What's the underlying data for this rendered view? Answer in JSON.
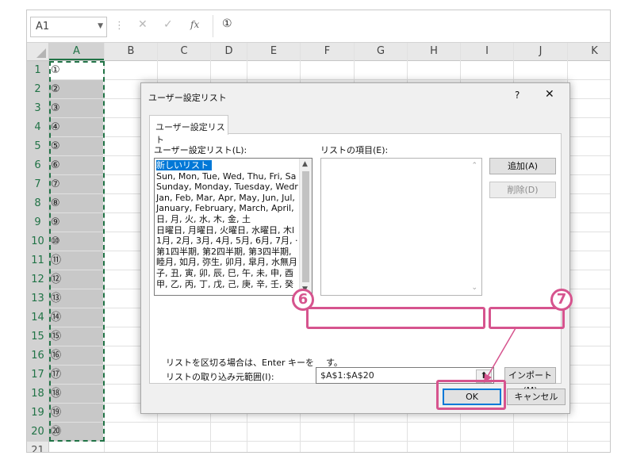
{
  "formula_bar": {
    "name_box": "A1",
    "cancel_symbol": "✕",
    "enter_symbol": "✓",
    "fx_symbol": "fx",
    "content": "①"
  },
  "columns": [
    "A",
    "B",
    "C",
    "D",
    "E",
    "F",
    "G",
    "H",
    "I",
    "J",
    "K"
  ],
  "rows": [
    {
      "n": "1",
      "a": "①"
    },
    {
      "n": "2",
      "a": "②"
    },
    {
      "n": "3",
      "a": "③"
    },
    {
      "n": "4",
      "a": "④"
    },
    {
      "n": "5",
      "a": "⑤"
    },
    {
      "n": "6",
      "a": "⑥"
    },
    {
      "n": "7",
      "a": "⑦"
    },
    {
      "n": "8",
      "a": "⑧"
    },
    {
      "n": "9",
      "a": "⑨"
    },
    {
      "n": "10",
      "a": "⑩"
    },
    {
      "n": "11",
      "a": "⑪"
    },
    {
      "n": "12",
      "a": "⑫"
    },
    {
      "n": "13",
      "a": "⑬"
    },
    {
      "n": "14",
      "a": "⑭"
    },
    {
      "n": "15",
      "a": "⑮"
    },
    {
      "n": "16",
      "a": "⑯"
    },
    {
      "n": "17",
      "a": "⑰"
    },
    {
      "n": "18",
      "a": "⑱"
    },
    {
      "n": "19",
      "a": "⑲"
    },
    {
      "n": "20",
      "a": "⑳"
    },
    {
      "n": "21",
      "a": ""
    }
  ],
  "dialog": {
    "title": "ユーザー設定リスト",
    "help": "?",
    "close": "✕",
    "tab": "ユーザー設定リスト",
    "list_label": "ユーザー設定リスト(L):",
    "entries_label": "リストの項目(E):",
    "list_items": [
      "新しいリスト",
      "Sun, Mon, Tue, Wed, Thu, Fri, Sa",
      "Sunday, Monday, Tuesday, Wedr",
      "Jan, Feb, Mar, Apr, May, Jun, Jul,",
      "January, February, March, April,",
      "日, 月, 火, 水, 木, 金, 土",
      "日曜日, 月曜日, 火曜日, 水曜日, 木l",
      "1月, 2月, 3月, 4月, 5月, 6月, 7月, ·",
      "第1四半期, 第2四半期, 第3四半期,",
      "睦月, 如月, 弥生, 卯月, 皐月, 水無月",
      "子, 丑, 寅, 卯, 辰, 巳, 午, 未, 申, 酉",
      "甲, 乙, 丙, 丁, 戊, 己, 庚, 辛, 壬, 癸"
    ],
    "add_button": "追加(A)",
    "delete_button": "削除(D)",
    "hint": "リストを区切る場合は、Enter キーを",
    "hint_tail": "す。",
    "import_label": "リストの取り込み元範囲(I):",
    "range_value": "$A$1:$A$20",
    "collapse_symbol": "⬆",
    "import_button": "インポート(M)",
    "ok_button": "OK",
    "cancel_button": "キャンセル"
  },
  "annotations": {
    "badge_6": "6",
    "badge_7": "7",
    "accent_color": "#d6548e"
  }
}
